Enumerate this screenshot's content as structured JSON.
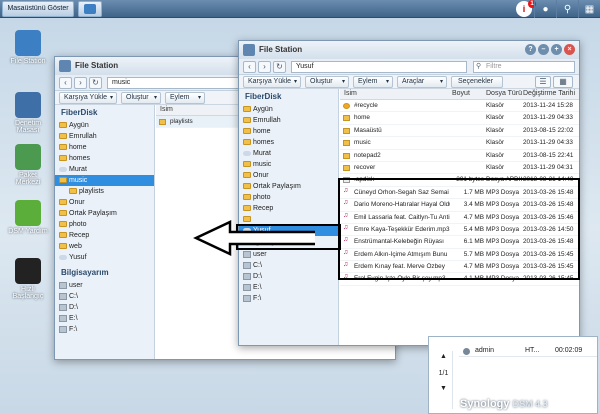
{
  "taskbar": {
    "show_desktop": "Masaüstünü Göster",
    "notification_count": "1"
  },
  "desktop_icons": [
    {
      "label": "File Station",
      "color": "#3c7fc2"
    },
    {
      "label": "Denetim Masası",
      "color": "#3f6fa7"
    },
    {
      "label": "Paket Merkezi",
      "color": "#4b9a4f"
    },
    {
      "label": "DSM Yardım",
      "color": "#5cae3a"
    },
    {
      "label": "Hızlı Başlangıç",
      "color": "#222"
    }
  ],
  "back_window": {
    "title": "File Station",
    "path": "music",
    "toolbar": [
      "Karşıya Yükle",
      "Oluştur",
      "Eylem"
    ],
    "tree_root": "FiberDisk",
    "tree": [
      {
        "label": "Aygün",
        "kind": "folder"
      },
      {
        "label": "Emrullah",
        "kind": "folder"
      },
      {
        "label": "home",
        "kind": "folder"
      },
      {
        "label": "homes",
        "kind": "folder"
      },
      {
        "label": "Murat",
        "kind": "cloud"
      },
      {
        "label": "music",
        "kind": "folder"
      },
      {
        "label": "playlists",
        "kind": "folder"
      },
      {
        "label": "Onur",
        "kind": "folder"
      },
      {
        "label": "Ortak Paylaşım",
        "kind": "folder"
      },
      {
        "label": "photo",
        "kind": "folder"
      },
      {
        "label": "Recep",
        "kind": "folder"
      },
      {
        "label": "web",
        "kind": "folder"
      },
      {
        "label": "Yusuf",
        "kind": "cloud"
      }
    ],
    "computer_root": "Bilgisayarım",
    "drives": [
      "user",
      "C:\\",
      "D:\\",
      "E:\\",
      "F:\\"
    ],
    "list_header": "İsim",
    "list_items": [
      "playlists"
    ]
  },
  "front_window": {
    "title": "File Station",
    "path": "Yusuf",
    "search_placeholder": "Filtre",
    "toolbar": [
      "Karşıya Yükle",
      "Oluştur",
      "Eylem",
      "Araçlar",
      "Seçenekler"
    ],
    "tree_root": "FiberDisk",
    "tree": [
      {
        "label": "Aygün",
        "kind": "folder"
      },
      {
        "label": "Emrullah",
        "kind": "folder"
      },
      {
        "label": "home",
        "kind": "folder"
      },
      {
        "label": "homes",
        "kind": "folder"
      },
      {
        "label": "Murat",
        "kind": "cloud"
      },
      {
        "label": "music",
        "kind": "folder"
      },
      {
        "label": "Onur",
        "kind": "folder"
      },
      {
        "label": "Ortak Paylaşım",
        "kind": "folder"
      },
      {
        "label": "photo",
        "kind": "folder"
      },
      {
        "label": "Recep",
        "kind": "folder"
      },
      {
        "label": "",
        "kind": "folder"
      },
      {
        "label": "Yusuf",
        "kind": "cloud"
      }
    ],
    "computer_root": "Bilgisayarım",
    "drives": [
      "user",
      "C:\\",
      "D:\\",
      "E:\\",
      "F:\\"
    ],
    "columns": {
      "name": "İsim",
      "size": "Boyut",
      "type": "Dosya Türü",
      "date": "Değiştirme Tarihi"
    },
    "rows": [
      {
        "name": "#recycle",
        "size": "",
        "type": "Klasör",
        "date": "2013-11-24 15:28",
        "icon": "recycle"
      },
      {
        "name": "home",
        "size": "",
        "type": "Klasör",
        "date": "2013-11-29 04:33",
        "icon": "folder"
      },
      {
        "name": "Masaüstü",
        "size": "",
        "type": "Klasör",
        "date": "2013-08-15 22:02",
        "icon": "folder"
      },
      {
        "name": "music",
        "size": "",
        "type": "Klasör",
        "date": "2013-11-29 04:33",
        "icon": "folder"
      },
      {
        "name": "notepad2",
        "size": "",
        "type": "Klasör",
        "date": "2013-08-15 22:41",
        "icon": "folder"
      },
      {
        "name": "recover",
        "size": "",
        "type": "Klasör",
        "date": "2013-11-29 04:31",
        "icon": "folder"
      },
      {
        "name": ".apdisk",
        "size": "291 bytes",
        "type": "Dosya APDISK",
        "date": "2013-08-21 14:40",
        "icon": "file"
      },
      {
        "name": "Cüneyd Orhon-Segah Saz Semai",
        "size": "1.7 MB",
        "type": "MP3 Dosya",
        "date": "2013-03-26 15:48",
        "icon": "music"
      },
      {
        "name": "Dario Moreno-Hatıralar Hayal Oldu",
        "size": "3.4 MB",
        "type": "MP3 Dosya",
        "date": "2013-03-26 15:48",
        "icon": "music"
      },
      {
        "name": "Emil Lassaria feat. Caitlyn-Tu Anti",
        "size": "4.7 MB",
        "type": "MP3 Dosya",
        "date": "2013-03-26 15:46",
        "icon": "music"
      },
      {
        "name": "Emre Kaya-Teşekkür Ederim.mp3",
        "size": "5.4 MB",
        "type": "MP3 Dosya",
        "date": "2013-03-26 14:50",
        "icon": "music"
      },
      {
        "name": "Enstrümantal-Kelebeğin Rüyası",
        "size": "6.1 MB",
        "type": "MP3 Dosya",
        "date": "2013-03-26 15:48",
        "icon": "music"
      },
      {
        "name": "Erdem Alkın-İçime Atmışım Bunu",
        "size": "5.7 MB",
        "type": "MP3 Dosya",
        "date": "2013-03-26 15:45",
        "icon": "music"
      },
      {
        "name": "Erdem Kınay feat. Merve Özbey",
        "size": "4.7 MB",
        "type": "MP3 Dosya",
        "date": "2013-03-26 15:45",
        "icon": "music"
      },
      {
        "name": "Erol Evgin-İşte Öyle Bir şey.mp3",
        "size": "4.1 MB",
        "type": "MP3 Dosya",
        "date": "2013-03-26 15:45",
        "icon": "music"
      }
    ]
  },
  "side_panel": {
    "user": "admin",
    "status": "HT...",
    "time": "00:02:09",
    "pager": "1/1"
  },
  "brand": {
    "name": "Synology",
    "product": "DSM 4.3"
  }
}
